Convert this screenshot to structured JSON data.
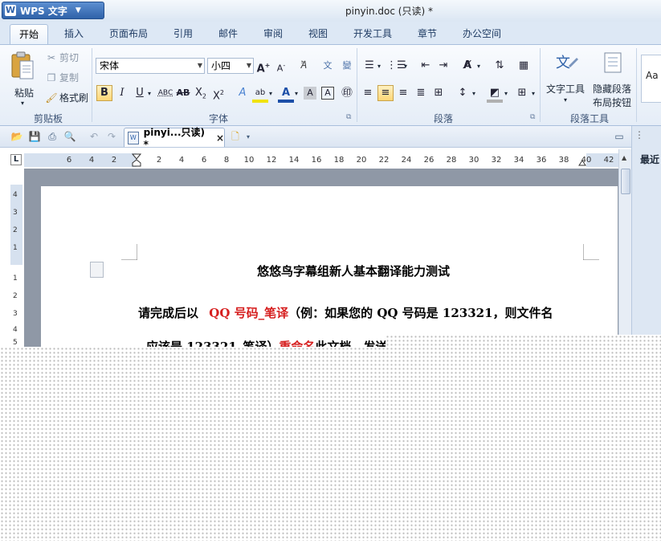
{
  "app": {
    "menu_label": "WPS 文字",
    "menu_logo": "W",
    "window_title": "pinyin.doc (只读) *"
  },
  "tabs": [
    "开始",
    "插入",
    "页面布局",
    "引用",
    "邮件",
    "审阅",
    "视图",
    "开发工具",
    "章节",
    "办公空间"
  ],
  "active_tab": "开始",
  "clipboard": {
    "paste": "粘贴",
    "cut": "剪切",
    "copy": "复制",
    "format_painter": "格式刷",
    "group": "剪贴板"
  },
  "font": {
    "family": "宋体",
    "size": "小四",
    "group": "字体"
  },
  "paragraph": {
    "group": "段落"
  },
  "paragraph_tools": {
    "text_tool": "文字工具",
    "hide_marks_line1": "隐藏段落",
    "hide_marks_line2": "布局按钮",
    "group": "段落工具"
  },
  "styles": {
    "preview": "Aa"
  },
  "doc_tab": {
    "label": "pinyi...只读) *",
    "close": "×"
  },
  "ruler": {
    "corner": "L",
    "h_numbers": [
      "6",
      "4",
      "2",
      "2",
      "4",
      "6",
      "8",
      "10",
      "12",
      "14",
      "16",
      "18",
      "20",
      "22",
      "24",
      "26",
      "28",
      "30",
      "32",
      "34",
      "36",
      "38",
      "40",
      "42"
    ],
    "v_numbers": [
      "4",
      "3",
      "2",
      "1",
      "1",
      "2",
      "3",
      "4",
      "5"
    ]
  },
  "taskpane": {
    "title": "最近"
  },
  "document": {
    "heading": "悠悠鸟字幕组新人基本翻译能力测试",
    "line1_a": "请完成后以",
    "line1_red": "QQ 号码_笔译",
    "line1_b": "（例：如果您的 QQ 号码是 123321，则文件名",
    "line2_a": "应该是 123321_笔译）",
    "line2_red": "重命名",
    "line2_b": "此文档，发送"
  },
  "colors": {
    "accent": "#2f62a9",
    "highlight_red": "#d61f1f",
    "ribbon_bg": "#e5edf7"
  }
}
